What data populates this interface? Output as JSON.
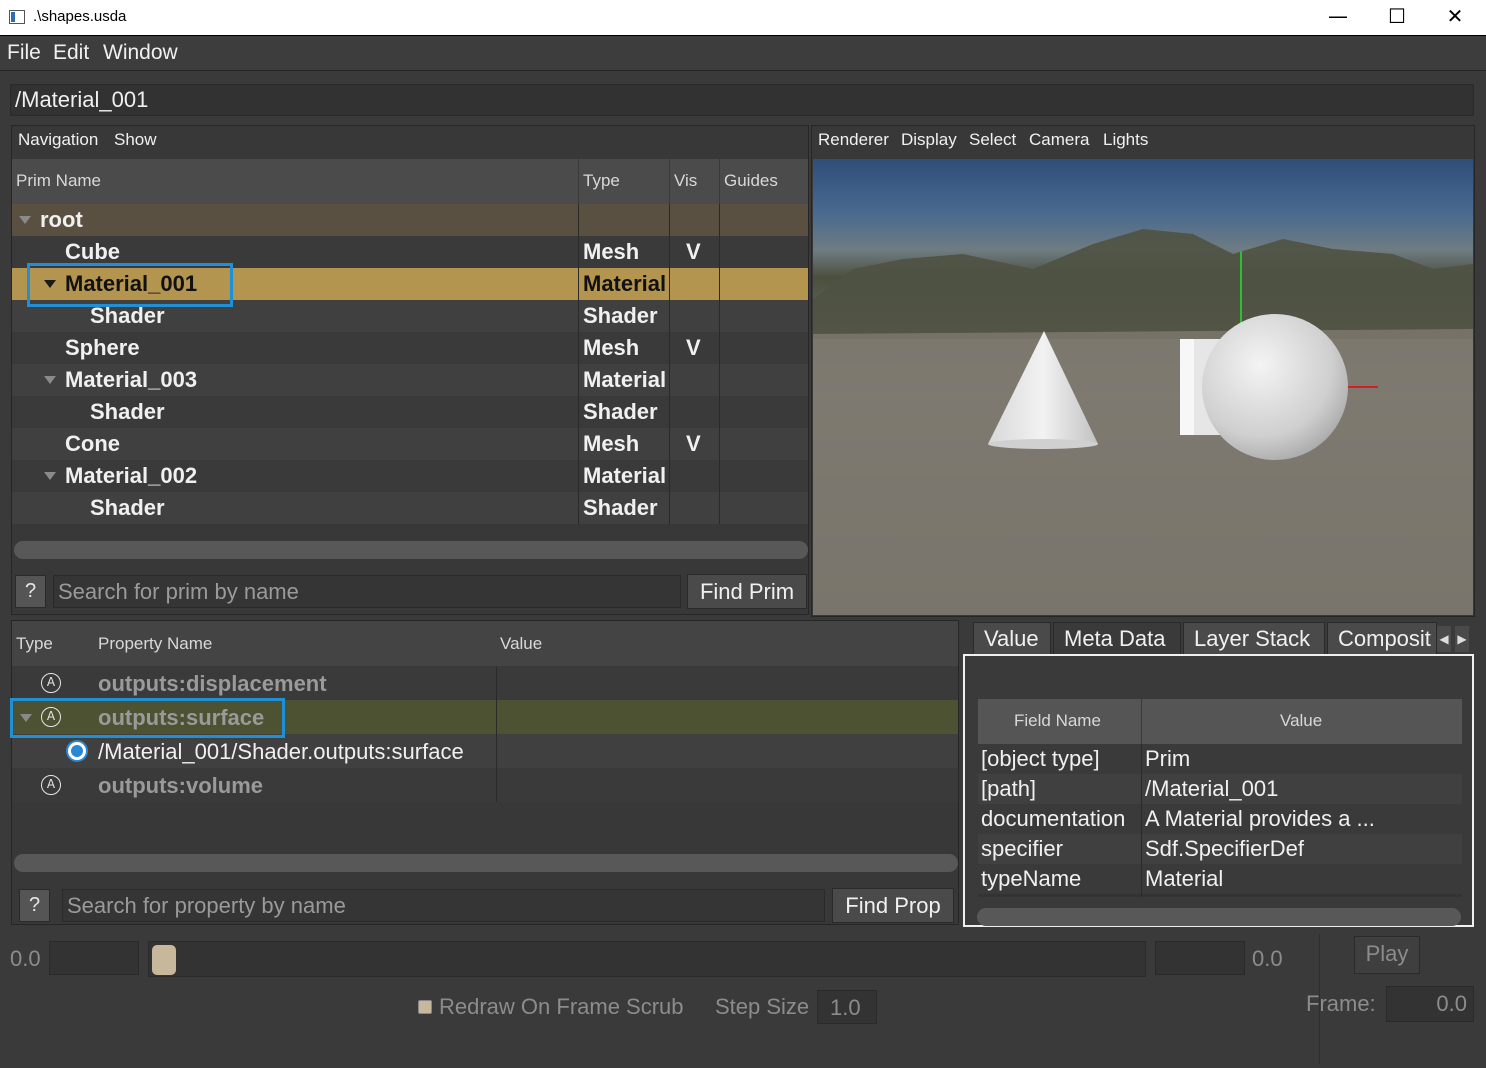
{
  "window": {
    "title": ".\\shapes.usda",
    "minimize": "—",
    "maximize": "☐",
    "close": "✕"
  },
  "menu": {
    "file": "File",
    "edit": "Edit",
    "window": "Window"
  },
  "path": "/Material_001",
  "prim_panel": {
    "menu": {
      "navigation": "Navigation",
      "show": "Show"
    },
    "columns": {
      "name": "Prim Name",
      "type": "Type",
      "vis": "Vis",
      "guides": "Guides"
    },
    "rows": [
      {
        "name": "root",
        "type": "",
        "vis": ""
      },
      {
        "name": "Cube",
        "type": "Mesh",
        "vis": "V"
      },
      {
        "name": "Material_001",
        "type": "Material",
        "vis": ""
      },
      {
        "name": "Shader",
        "type": "Shader",
        "vis": ""
      },
      {
        "name": "Sphere",
        "type": "Mesh",
        "vis": "V"
      },
      {
        "name": "Material_003",
        "type": "Material",
        "vis": ""
      },
      {
        "name": "Shader",
        "type": "Shader",
        "vis": ""
      },
      {
        "name": "Cone",
        "type": "Mesh",
        "vis": "V"
      },
      {
        "name": "Material_002",
        "type": "Material",
        "vis": ""
      },
      {
        "name": "Shader",
        "type": "Shader",
        "vis": ""
      }
    ],
    "help_label": "?",
    "search_placeholder": "Search for prim by name",
    "find_label": "Find Prim"
  },
  "viewer": {
    "menu": {
      "renderer": "Renderer",
      "display": "Display",
      "select": "Select",
      "camera": "Camera",
      "lights": "Lights"
    }
  },
  "property_panel": {
    "columns": {
      "type": "Type",
      "name": "Property Name",
      "value": "Value"
    },
    "rows": [
      {
        "icon": "attribute-icon",
        "name": "outputs:displacement",
        "value": ""
      },
      {
        "icon": "attribute-connected-icon",
        "name": "outputs:surface",
        "value": ""
      },
      {
        "icon": "connection-icon",
        "name": "/Material_001/Shader.outputs:surface",
        "value": ""
      },
      {
        "icon": "attribute-icon",
        "name": "outputs:volume",
        "value": ""
      }
    ],
    "attr_glyph": "A",
    "help_label": "?",
    "search_placeholder": "Search for property by name",
    "find_label": "Find Prop"
  },
  "inspector": {
    "tabs": [
      "Value",
      "Meta Data",
      "Layer Stack",
      "Composit"
    ],
    "active_tab": "Meta Data",
    "columns": {
      "field": "Field Name",
      "value": "Value"
    },
    "rows": [
      {
        "field": "[object type]",
        "value": "Prim"
      },
      {
        "field": "[path]",
        "value": "/Material_001"
      },
      {
        "field": "documentation",
        "value": "A Material provides a ..."
      },
      {
        "field": "specifier",
        "value": "Sdf.SpecifierDef"
      },
      {
        "field": "typeName",
        "value": "Material"
      }
    ]
  },
  "timeline": {
    "start": "0.0",
    "end": "0.0",
    "play_label": "Play",
    "redraw_label": "Redraw On Frame Scrub",
    "step_label": "Step Size",
    "step_value": "1.0",
    "frame_label": "Frame:",
    "frame_value": "0.0",
    "slider_position": 0.0
  },
  "colors": {
    "selection": "#b4954f",
    "highlight_border": "#1f8fd6",
    "root_row": "#5a5041",
    "attr_muted": "#9a9a9a"
  }
}
